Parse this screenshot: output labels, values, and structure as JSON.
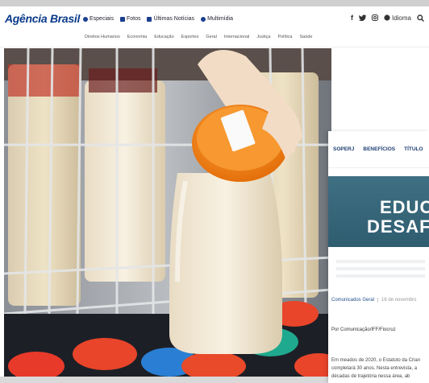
{
  "header": {
    "logo": "Agência Brasil",
    "nav": [
      {
        "label": "Especiais",
        "icon": "star-icon"
      },
      {
        "label": "Fotos",
        "icon": "camera-icon"
      },
      {
        "label": "Últimas Notícias",
        "icon": "list-icon"
      },
      {
        "label": "Multimídia",
        "icon": "play-icon"
      }
    ],
    "idioma": "Idioma"
  },
  "subnav": [
    "Direitos Humanos",
    "Economia",
    "Educação",
    "Esportes",
    "Geral",
    "Internacional",
    "Justiça",
    "Política",
    "Saúde"
  ],
  "overlay": {
    "nav": [
      "SOPERJ",
      "BENEFÍCIOS",
      "TÍTULO"
    ],
    "banner_line1": "EDUC",
    "banner_line2": "DESAF",
    "category": "Comunicados Geral",
    "date": "16 de novembro",
    "author": "Por Comunicação/IFF/Fiocruz",
    "body": [
      "Em meados de 2020, o Estatuto da Crian",
      "completará 30 anos. Nesta entrevista, a",
      "décadas de trajetória nessa área, ab"
    ]
  },
  "colors": {
    "brand": "#0a3a8a",
    "banner": "#2f5d70",
    "cap_orange": "#f48a1a"
  }
}
